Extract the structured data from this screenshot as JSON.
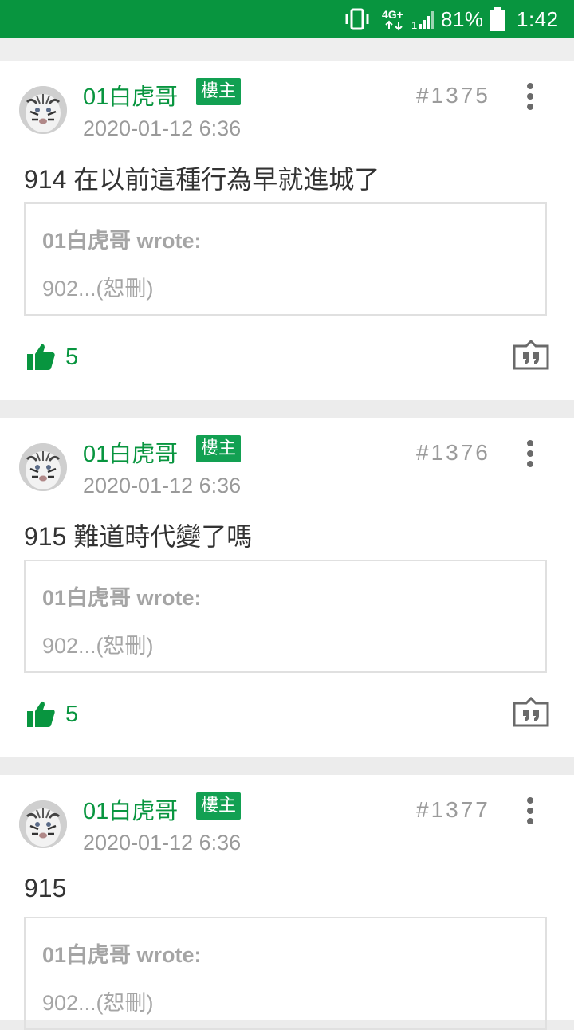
{
  "status_bar": {
    "network": "4G",
    "battery": "81%",
    "time": "1:42",
    "icons": [
      "vibrate-icon",
      "network-4g-icon",
      "signal-icon",
      "battery-icon"
    ]
  },
  "posts": [
    {
      "author": "01白虎哥",
      "badge": "樓主",
      "number": "#1375",
      "time": "2020-01-12 6:36",
      "text": "914 在以前這種行為早就進城了",
      "quote_head": "01白虎哥 wrote:",
      "quote_body": "902...(恕刪)",
      "likes": "5"
    },
    {
      "author": "01白虎哥",
      "badge": "樓主",
      "number": "#1376",
      "time": "2020-01-12 6:36",
      "text": "915 難道時代變了嗎",
      "quote_head": "01白虎哥 wrote:",
      "quote_body": "902...(恕刪)",
      "likes": "5"
    },
    {
      "author": "01白虎哥",
      "badge": "樓主",
      "number": "#1377",
      "time": "2020-01-12 6:36",
      "text": "915",
      "quote_head": "01白虎哥 wrote:",
      "quote_body": "902...(恕刪)",
      "likes": ""
    }
  ],
  "colors": {
    "status_bar_bg": "#08953f",
    "accent_green": "#08953f",
    "badge_bg": "#12a052",
    "separator": "#ececec"
  }
}
